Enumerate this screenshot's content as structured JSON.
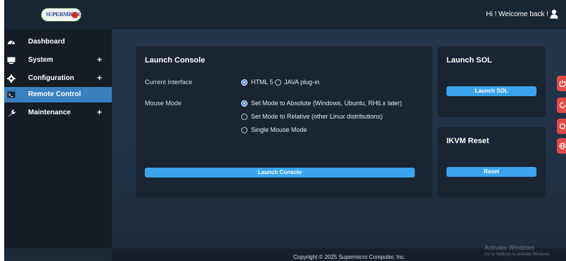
{
  "header": {
    "logo_text": "SUPERMICRO",
    "welcome": "Hi ! Welcome back !",
    "user_icon": "user-icon"
  },
  "sidebar": {
    "items": [
      {
        "label": "Dashboard",
        "icon": "dashboard-icon",
        "expandable": false,
        "active": false
      },
      {
        "label": "System",
        "icon": "monitor-icon",
        "expandable": true,
        "active": false
      },
      {
        "label": "Configuration",
        "icon": "gear-icon",
        "expandable": true,
        "active": false
      },
      {
        "label": "Remote Control",
        "icon": "terminal-icon",
        "expandable": false,
        "active": true
      },
      {
        "label": "Maintenance",
        "icon": "wrench-icon",
        "expandable": true,
        "active": false
      }
    ],
    "expand_symbol": "+"
  },
  "launch_console": {
    "title": "Launch Console",
    "interface_label": "Current Interface",
    "interface_options": [
      {
        "label": "HTML 5",
        "checked": true
      },
      {
        "label": "JAVA plug-in",
        "checked": false
      }
    ],
    "mouse_label": "Mouse Mode",
    "mouse_options": [
      {
        "label": "Set Mode to Absolute (Windows, Ubuntu, RH6.x later)",
        "checked": true
      },
      {
        "label": "Set Mode to Relative (other Linux distributions)",
        "checked": false
      },
      {
        "label": "Single Mouse Mode",
        "checked": false
      }
    ],
    "button_label": "Launch Console"
  },
  "launch_sol": {
    "title": "Launch SOL",
    "button_label": "Launch SOL"
  },
  "ikvm_reset": {
    "title": "IKVM Reset",
    "button_label": "Reset"
  },
  "footer": {
    "copyright": "Copyright © 2025 Supermicro Computer, Inc."
  },
  "watermark": {
    "title": "Activate Windows",
    "subtitle": "Go to Settings to activate Windows."
  },
  "side_tabs": [
    "power-icon",
    "refresh-icon",
    "cycle-icon",
    "globe-icon"
  ],
  "colors": {
    "accent": "#3aa5ee",
    "active_nav": "#3a80c0",
    "panel": "#1a2533",
    "side_tab": "#e24a4a"
  }
}
